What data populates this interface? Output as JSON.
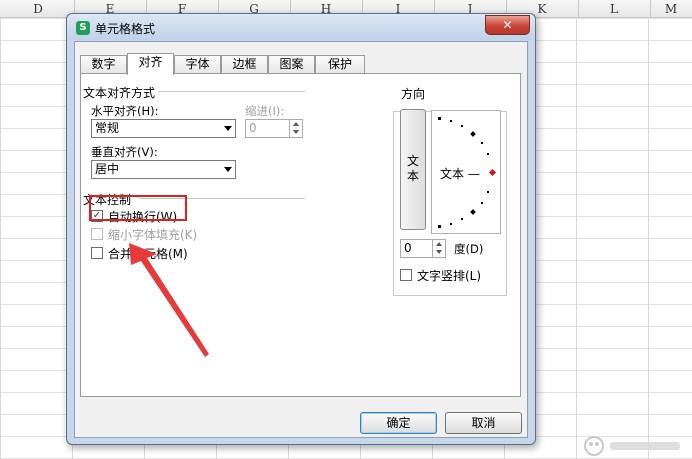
{
  "spreadsheet": {
    "columns": [
      "D",
      "E",
      "F",
      "G",
      "H",
      "I",
      "J",
      "K",
      "L",
      "M"
    ]
  },
  "dialog": {
    "title": "单元格格式",
    "app_icon_glyph": "S",
    "close_glyph": "✕",
    "tabs": [
      {
        "label": "数字",
        "active": false
      },
      {
        "label": "对齐",
        "active": true
      },
      {
        "label": "字体",
        "active": false
      },
      {
        "label": "边框",
        "active": false
      },
      {
        "label": "图案",
        "active": false
      },
      {
        "label": "保护",
        "active": false
      }
    ],
    "text_alignment": {
      "section_label": "文本对齐方式",
      "horizontal_label": "水平对齐(H):",
      "horizontal_value": "常规",
      "indent_label": "缩进(I):",
      "indent_value": "0",
      "vertical_label": "垂直对齐(V):",
      "vertical_value": "居中"
    },
    "text_control": {
      "section_label": "文本控制",
      "wrap_text": {
        "label": "自动换行(W)",
        "checked": true,
        "enabled": true
      },
      "shrink_to_fit": {
        "label": "缩小字体填充(K)",
        "checked": false,
        "enabled": false
      },
      "merge_cells": {
        "label": "合并单元格(M)",
        "checked": false,
        "enabled": true
      }
    },
    "orientation": {
      "section_label": "方向",
      "vertical_text": "文本",
      "dial_text": "文本 —",
      "degree_value": "0",
      "degree_label": "度(D)",
      "vertical_layout": {
        "label": "文字竖排(L)",
        "checked": false
      }
    },
    "buttons": {
      "ok": "确定",
      "cancel": "取消"
    }
  },
  "annotation": {
    "highlight_color": "#e02020",
    "arrow_color": "#e83a3a"
  }
}
